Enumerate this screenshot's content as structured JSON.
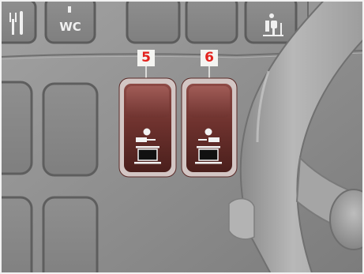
{
  "callouts": {
    "switch_5": "5",
    "switch_6": "6"
  },
  "panel_labels": {
    "wc": "WC"
  },
  "icons": {
    "top_left": "cutlery-icon",
    "top_center": "wc-icon",
    "top_right": "passenger-seat-icon",
    "switch_5_symbol": "person-table-icon",
    "switch_6_symbol": "person-table-icon"
  },
  "colors": {
    "panel": "#8e8e8e",
    "switch_body": "#6b2f2c",
    "switch_highlight": "#8a4a45",
    "switch_frame": "#c7b9b7",
    "callout_number": "#e3231e",
    "callout_background": "#f4f4f1",
    "steering_wheel": "#9b9b9b"
  }
}
